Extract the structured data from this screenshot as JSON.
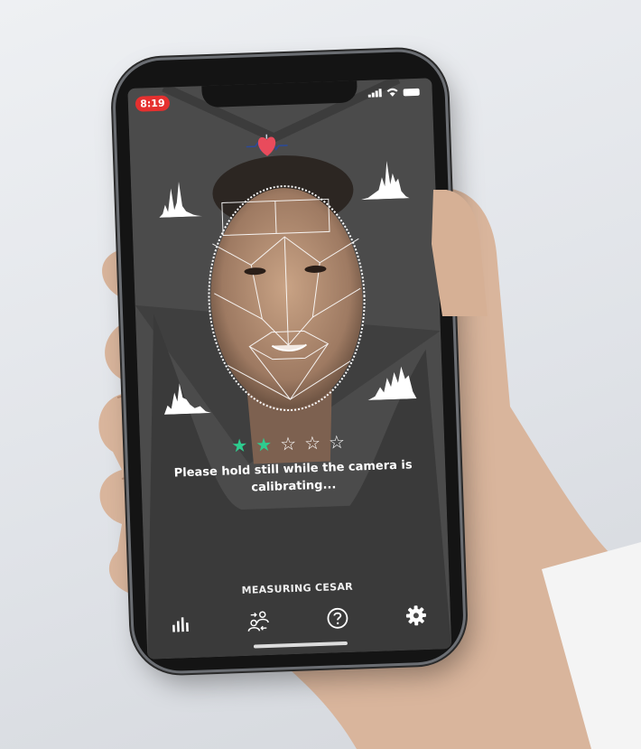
{
  "status_bar": {
    "time": "8:19"
  },
  "camera": {
    "stars_filled": 2,
    "stars_total": 5,
    "message": "Please hold still while the camera is calibrating..."
  },
  "measuring_label": "MEASURING CESAR",
  "tabs": [
    {
      "icon": "bar-chart-icon"
    },
    {
      "icon": "switch-user-icon"
    },
    {
      "icon": "help-icon"
    },
    {
      "icon": "gear-icon"
    }
  ],
  "colors": {
    "accent_green": "#2ecc8f",
    "status_red": "#e5302f",
    "heart_red": "#e94b5c",
    "screen_bg": "#4a4a4a"
  }
}
